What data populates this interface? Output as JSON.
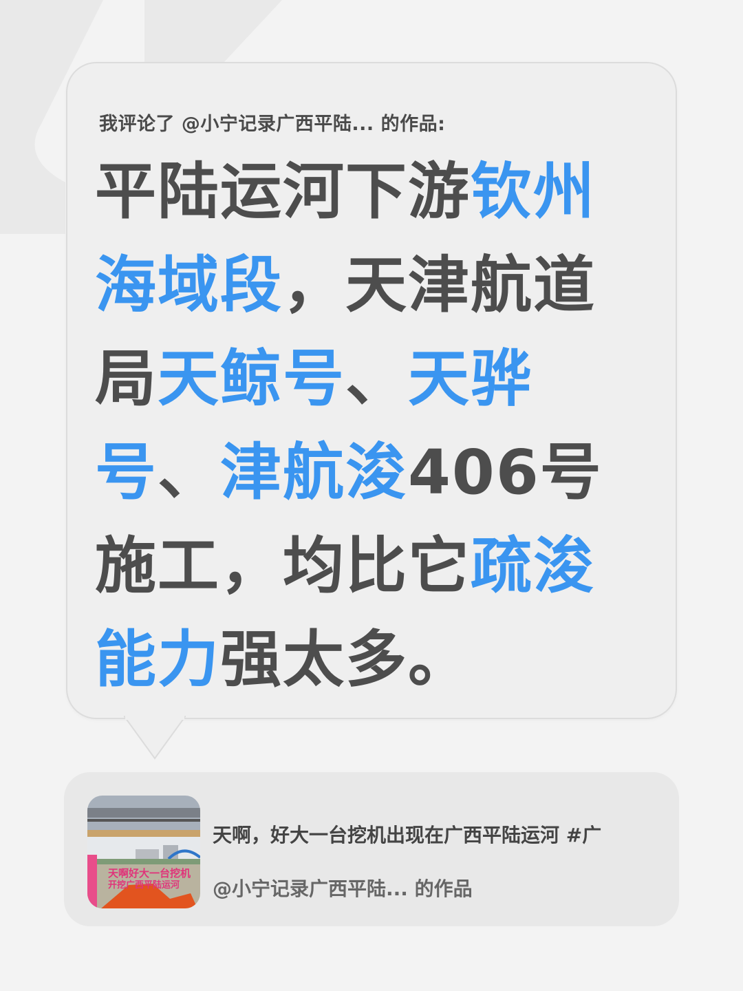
{
  "comment": {
    "header": "我评论了 @小宁记录广西平陆... 的作品:",
    "lines": [
      [
        {
          "t": "平陆运河下游",
          "hl": false
        },
        {
          "t": "钦州",
          "hl": true
        }
      ],
      [
        {
          "t": "海域段",
          "hl": true
        },
        {
          "t": "，天津航道",
          "hl": false
        }
      ],
      [
        {
          "t": "局",
          "hl": false
        },
        {
          "t": "天鲸号",
          "hl": true
        },
        {
          "t": "、",
          "hl": false
        },
        {
          "t": "天骅",
          "hl": true
        }
      ],
      [
        {
          "t": "号",
          "hl": true
        },
        {
          "t": "、",
          "hl": false
        },
        {
          "t": "津航浚",
          "hl": true
        },
        {
          "t": "406号",
          "hl": false
        }
      ],
      [
        {
          "t": "施工，均比它",
          "hl": false
        },
        {
          "t": "疏浚",
          "hl": true
        }
      ],
      [
        {
          "t": "能力",
          "hl": true
        },
        {
          "t": "强太多。",
          "hl": false
        }
      ]
    ]
  },
  "video_card": {
    "title": "天啊，好大一台挖机出现在广西平陆运河 #广",
    "author": "@小宁记录广西平陆... 的作品",
    "thumbnail_caption_line1": "天啊好大一台挖机",
    "thumbnail_caption_line2": "开挖广西平陆运河"
  },
  "colors": {
    "highlight": "#3a95f0",
    "text": "#4d4d4d",
    "background": "#f3f3f3",
    "bubble": "#efefef",
    "card": "#e8e8e8"
  },
  "icons": [
    "quote-mark-icon"
  ]
}
